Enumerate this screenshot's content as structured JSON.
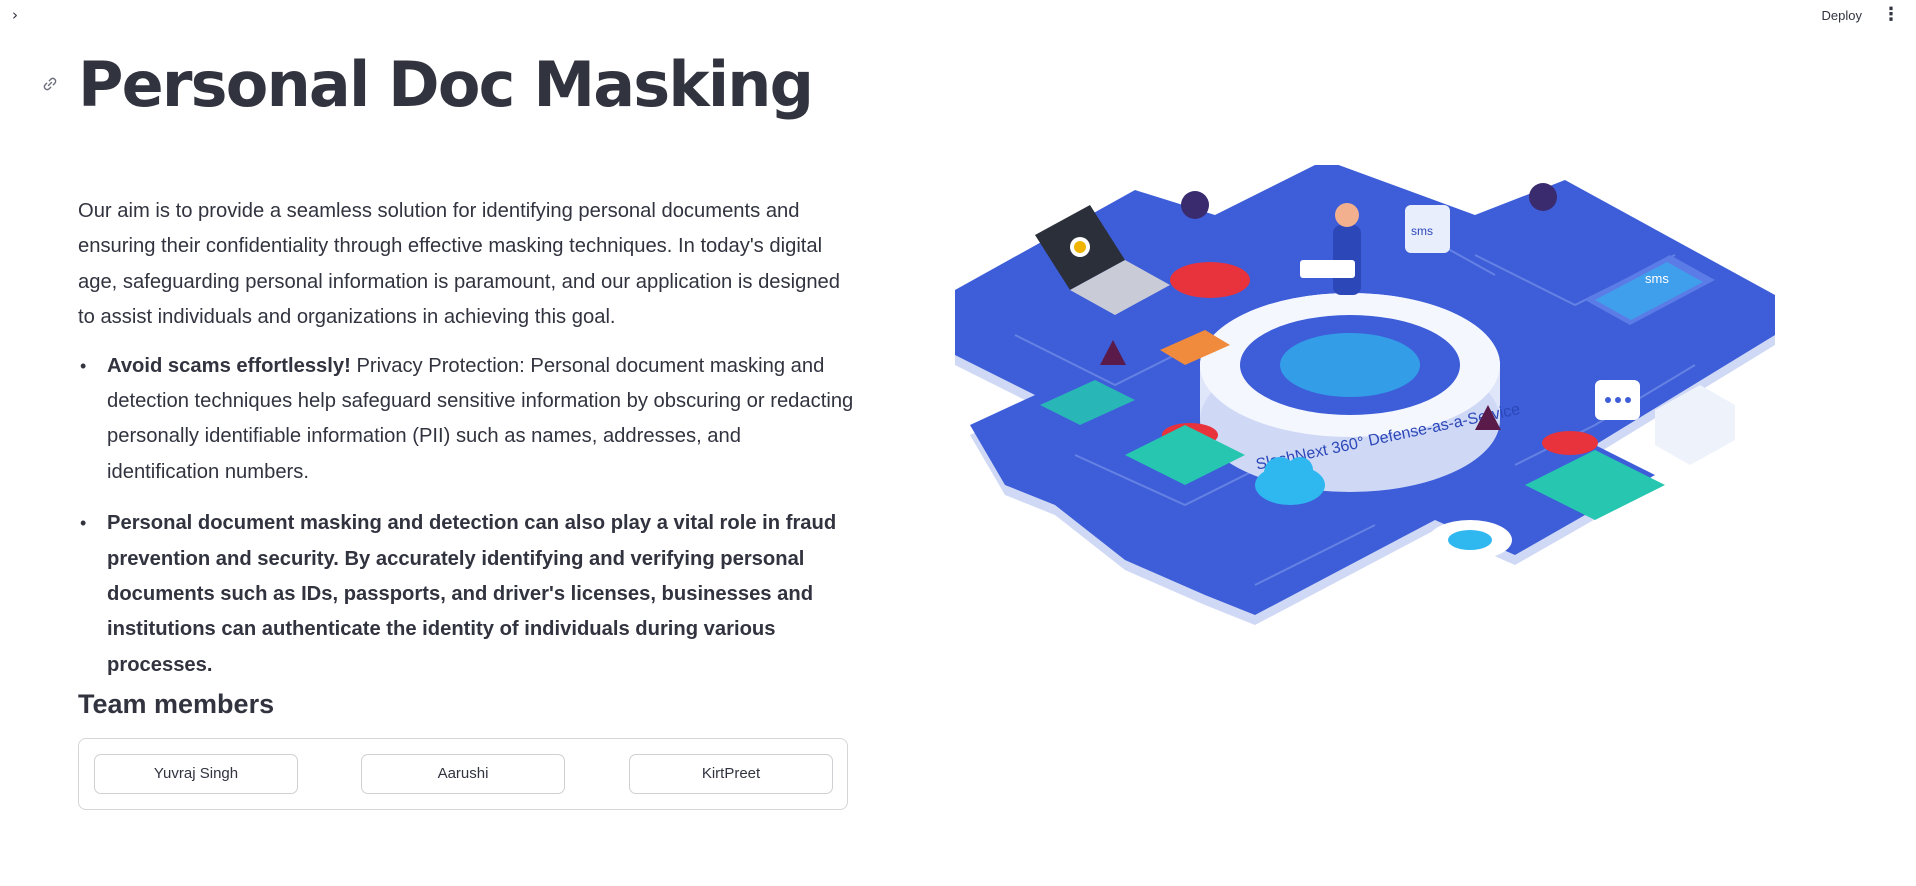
{
  "topbar": {
    "sidebar_toggle_glyph": "›",
    "deploy_label": "Deploy",
    "menu_glyph": "⋮"
  },
  "page": {
    "title": "Personal Doc Masking",
    "intro": "Our aim is to provide a seamless solution for identifying personal documents and ensuring their confidentiality through effective masking techniques. In today's digital age, safeguarding personal information is paramount, and our application is designed to assist individuals and organizations in achieving this goal.",
    "bullets": [
      {
        "bold": "Avoid scams effortlessly!",
        "text": " Privacy Protection: Personal document masking and detection techniques help safeguard sensitive information by obscuring or redacting personally identifiable information (PII) such as names, addresses, and identification numbers."
      },
      {
        "bold": "Personal document masking and detection can also play a vital role in fraud prevention and security. By accurately identifying and verifying personal documents such as IDs, passports, and driver's licenses, businesses and institutions can authenticate the identity of individuals during various processes.",
        "text": ""
      }
    ],
    "team_heading": "Team members",
    "team_members": [
      "Yuvraj Singh",
      "Aarushi",
      "KirtPreet"
    ]
  },
  "illustration": {
    "ring_label": "SlashNext 360° Defense-as-a-Service",
    "app_labels": [
      "sms",
      "sms"
    ],
    "colors": {
      "platform": "#3d5ed8",
      "platform_edge": "#b8c6f0",
      "alert_red": "#e8333c",
      "accent_teal": "#26c6b0",
      "cloud_blue": "#2fb8f0"
    }
  }
}
